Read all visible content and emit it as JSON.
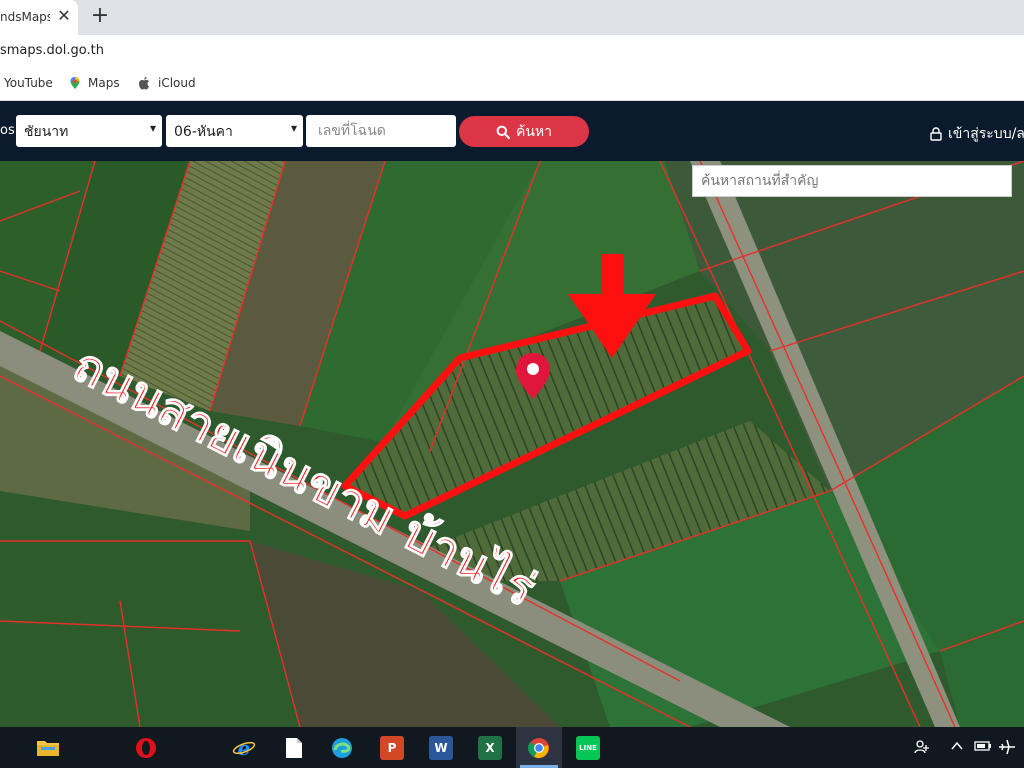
{
  "browser": {
    "tab_title": "ndsMaps",
    "tab_close": "✕",
    "new_tab": "+",
    "url": "smaps.dol.go.th"
  },
  "bookmarks": [
    {
      "label": "YouTube",
      "icon": "youtube-icon"
    },
    {
      "label": "Maps",
      "icon": "maps-pin-icon"
    },
    {
      "label": "iCloud",
      "icon": "apple-icon"
    }
  ],
  "nav": {
    "edge_text": "os",
    "province": "ชัยนาท",
    "district": "06-หันคา",
    "parcel_placeholder": "เลขที่โฉนด",
    "search_label": "ค้นหา",
    "login_label": "เข้าสู่ระบบ/ล"
  },
  "map": {
    "place_search_placeholder": "ค้นหาสถานที่สำคัญ",
    "road_annotation": "ถนนสายเนินขาม บ้านไร่",
    "annotation_color": "#ff1010",
    "boundary_color": "#e8302a"
  },
  "taskbar": {
    "apps": [
      {
        "name": "file-explorer-icon",
        "color": "#f5c542"
      },
      {
        "name": "opera-icon",
        "color": "#e0101a"
      },
      {
        "name": "internet-explorer-icon",
        "color": "#1e90ff"
      },
      {
        "name": "file-icon",
        "color": "#ffffff"
      },
      {
        "name": "edge-icon",
        "color": "#1a9fe0"
      },
      {
        "name": "powerpoint-icon",
        "color": "#d24726",
        "letter": "P"
      },
      {
        "name": "word-icon",
        "color": "#2b579a",
        "letter": "W"
      },
      {
        "name": "excel-icon",
        "color": "#217346",
        "letter": "X"
      },
      {
        "name": "chrome-icon",
        "color": "#e8b324"
      },
      {
        "name": "line-icon",
        "color": "#06c755",
        "letter": "LINE"
      }
    ]
  }
}
